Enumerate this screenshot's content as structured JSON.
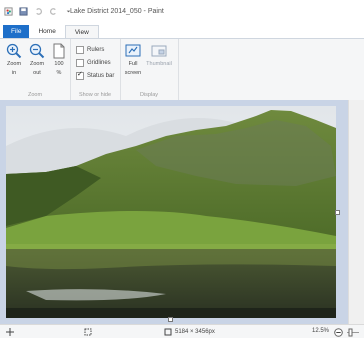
{
  "window": {
    "title": "Lake District 2014_050 - Paint"
  },
  "ribbon": {
    "tabs": [
      "File",
      "Home",
      "View"
    ],
    "groups": {
      "zoom": {
        "label": "Zoom",
        "zoom_in": [
          "Zoom",
          "in"
        ],
        "zoom_out": [
          "Zoom",
          "out"
        ],
        "hundred": [
          "100",
          "%"
        ]
      },
      "show_hide": {
        "label": "Show or hide",
        "rulers": "Rulers",
        "gridlines": "Gridlines",
        "status_bar": "Status bar",
        "rulers_checked": false,
        "gridlines_checked": false,
        "status_bar_checked": true
      },
      "display": {
        "label": "Display",
        "full_screen": [
          "Full",
          "screen"
        ],
        "thumbnail": "Thumbnail"
      }
    }
  },
  "status": {
    "dimensions": "5184 × 3456px",
    "zoom": "12.5%"
  },
  "colors": {
    "accent": "#1e6fc9",
    "canvas_bg": "#c9d4e6"
  }
}
